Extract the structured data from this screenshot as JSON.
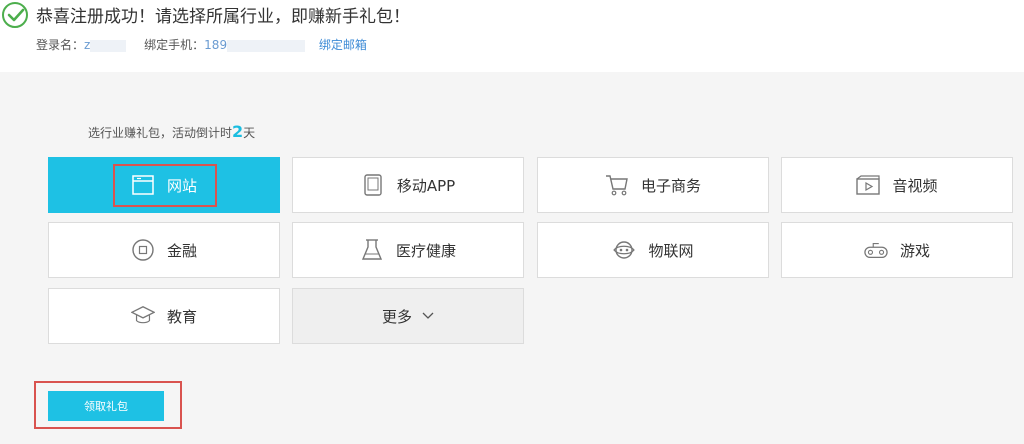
{
  "header": {
    "headline": "恭喜注册成功！请选择所属行业，即赚新手礼包！",
    "login_label": "登录名：",
    "login_value": "z",
    "phone_label": "绑定手机：",
    "phone_value": "189",
    "bind_email_link": "绑定邮箱"
  },
  "hint": {
    "prefix": "选行业赚礼包，活动倒计时",
    "days": "2",
    "suffix": "天"
  },
  "industries": [
    {
      "label": "网站",
      "icon": "browser-window-icon",
      "selected": true
    },
    {
      "label": "移动APP",
      "icon": "tablet-icon",
      "selected": false
    },
    {
      "label": "电子商务",
      "icon": "shopping-cart-icon",
      "selected": false
    },
    {
      "label": "音视频",
      "icon": "video-player-icon",
      "selected": false
    },
    {
      "label": "金融",
      "icon": "coin-icon",
      "selected": false
    },
    {
      "label": "医疗健康",
      "icon": "flask-icon",
      "selected": false
    },
    {
      "label": "物联网",
      "icon": "iot-globe-icon",
      "selected": false
    },
    {
      "label": "游戏",
      "icon": "gamepad-icon",
      "selected": false
    },
    {
      "label": "教育",
      "icon": "graduation-cap-icon",
      "selected": false
    }
  ],
  "more": {
    "label": "更多",
    "icon": "chevron-down-icon"
  },
  "claim_button": "领取礼包",
  "colors": {
    "accent": "#1ec1e4",
    "success": "#4cae4c",
    "highlight_box": "#d9534f",
    "link": "#3d8bd6"
  }
}
